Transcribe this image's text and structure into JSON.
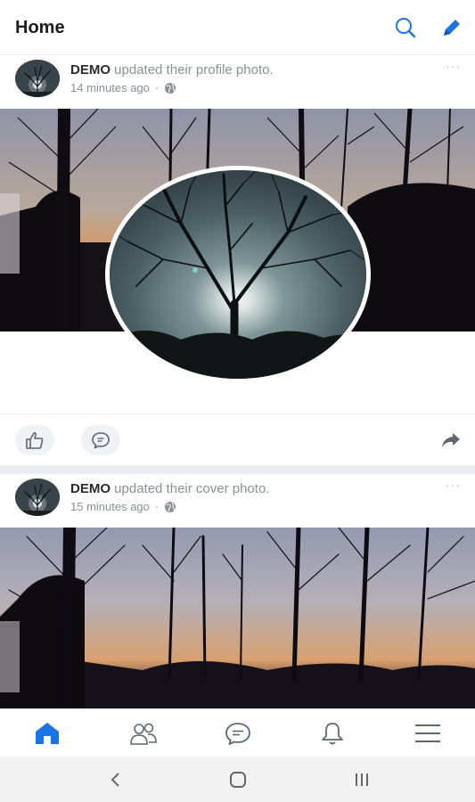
{
  "header": {
    "title": "Home",
    "search_icon": "search-icon",
    "compose_icon": "pencil-icon",
    "accent_color": "#1b74e4"
  },
  "feed": {
    "posts": [
      {
        "author": "DEMO",
        "action": " updated their profile photo.",
        "time": "14 minutes ago",
        "separator": "·",
        "privacy_icon": "globe-icon",
        "more_label": "···"
      },
      {
        "author": "DEMO",
        "action": " updated their cover photo.",
        "time": "15 minutes ago",
        "separator": "·",
        "privacy_icon": "globe-icon",
        "more_label": "···"
      }
    ],
    "actions": {
      "like_icon": "thumbs-up-icon",
      "comment_icon": "comment-icon",
      "share_icon": "share-arrow-icon"
    }
  },
  "bottom_nav": {
    "items": [
      "home-icon",
      "friends-icon",
      "messages-icon",
      "notifications-icon",
      "menu-icon"
    ],
    "active": "home-icon"
  },
  "system_nav": {
    "items": [
      "back-icon",
      "home-circle-icon",
      "recent-apps-icon"
    ]
  }
}
